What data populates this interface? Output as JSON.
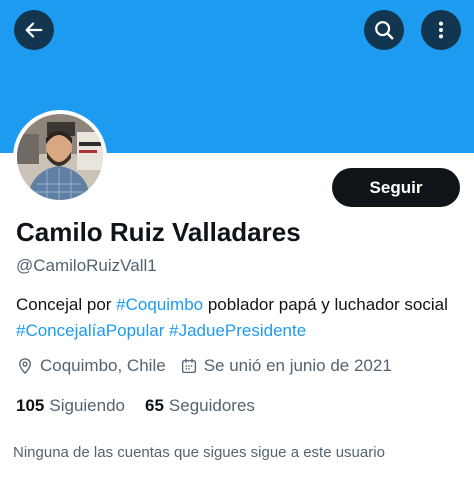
{
  "header": {
    "back_icon": "arrow-left-icon",
    "search_icon": "search-icon",
    "more_icon": "more-vertical-icon"
  },
  "colors": {
    "banner": "#1d9bf0",
    "accent": "#1d9bf0",
    "primary_text": "#0f1419",
    "secondary_text": "#536471",
    "button_bg": "#0f1419"
  },
  "profile": {
    "display_name": "Camilo Ruiz Valladares",
    "handle": "@CamiloRuizVall1",
    "follow_label": "Seguir",
    "bio": {
      "segments": [
        "Concejal por ",
        "#Coquimbo",
        " poblador papá y luchador social ",
        "#ConcejalíaPopular",
        " ",
        "#JaduePresidente"
      ]
    },
    "location": "Coquimbo, Chile",
    "joined": "Se unió en junio de 2021",
    "following_count": "105",
    "following_label": "Siguiendo",
    "followers_count": "65",
    "followers_label": "Seguidores",
    "mutual_note": "Ninguna de las cuentas que sigues sigue a este usuario"
  }
}
